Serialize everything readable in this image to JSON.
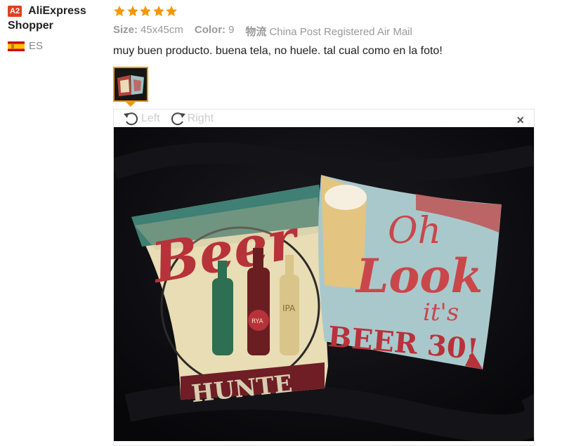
{
  "user": {
    "badge": "A2",
    "name_line1": "AliExpress",
    "name_line2": "Shopper",
    "country_code": "ES",
    "flag_icon": "spain-flag-icon"
  },
  "review": {
    "rating": 5,
    "star_color": "#f39800",
    "size_label": "Size:",
    "size_value": "45x45cm",
    "color_label": "Color:",
    "color_value": "9",
    "shipping_label": "物流",
    "shipping_value": "China Post Registered Air Mail",
    "text": "muy buen producto. buena tela, no huele. tal cual como en la foto!"
  },
  "viewer": {
    "rotate_left_label": "Left",
    "rotate_right_label": "Right",
    "close_label": "×",
    "photo_text": {
      "left_pillow_title": "Beer",
      "left_pillow_bottom": "HUNTE",
      "right_pillow_line1": "Oh",
      "right_pillow_line2": "Look",
      "right_pillow_line3": "it's",
      "right_pillow_line4": "BEER 30!",
      "bottle_label": "IPA",
      "bottle_label_red": "RYA"
    }
  }
}
